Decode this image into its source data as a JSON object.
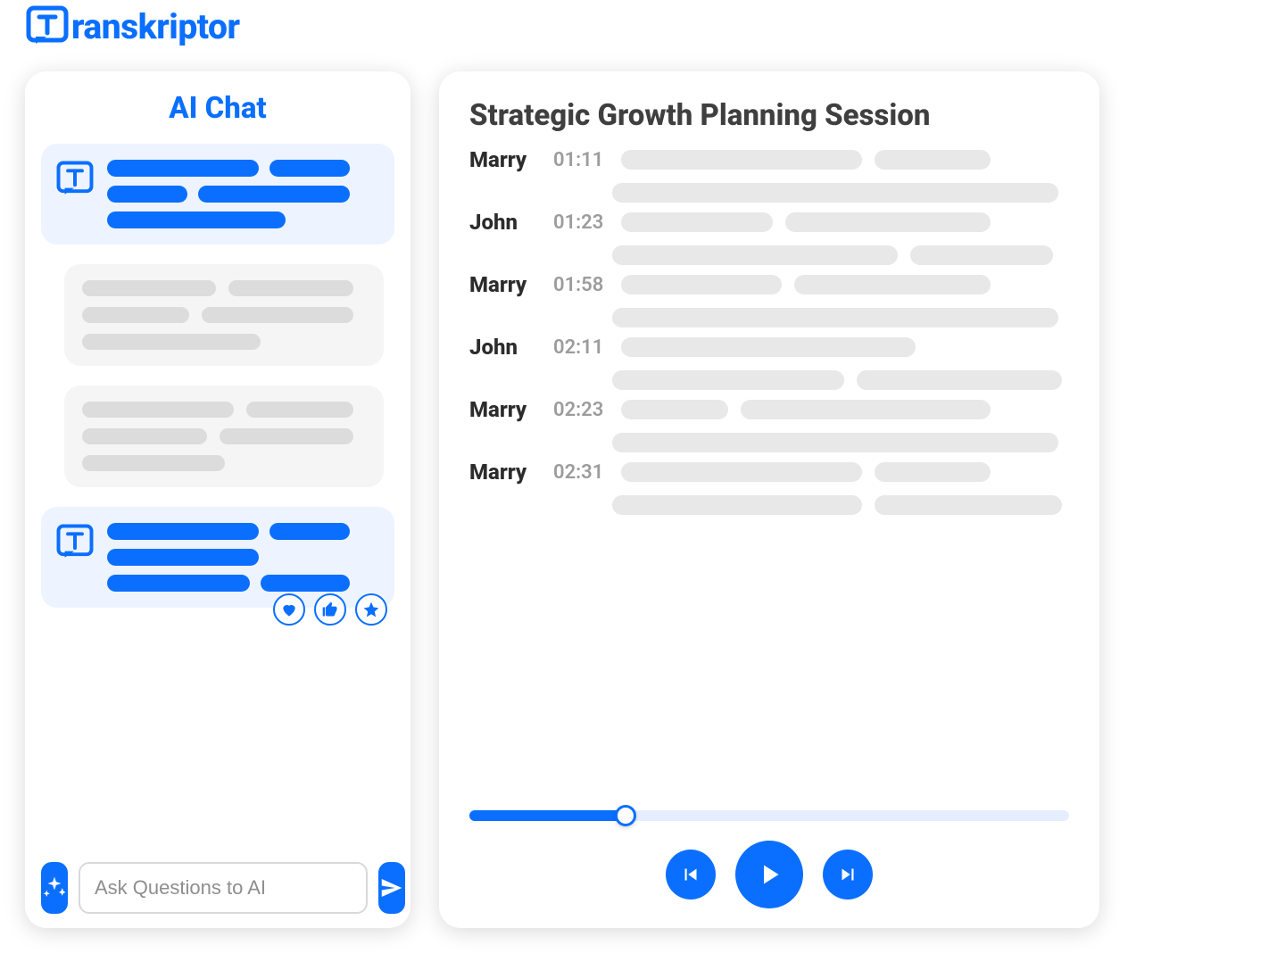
{
  "brand": {
    "name": "ranskriptor"
  },
  "chat": {
    "title": "AI Chat",
    "input_placeholder": "Ask Questions to AI"
  },
  "session": {
    "title": "Strategic Growth Planning Session",
    "entries": [
      {
        "speaker": "Marry",
        "time": "01:11"
      },
      {
        "speaker": "John",
        "time": "01:23"
      },
      {
        "speaker": "Marry",
        "time": "01:58"
      },
      {
        "speaker": "John",
        "time": "02:11"
      },
      {
        "speaker": "Marry",
        "time": "02:23"
      },
      {
        "speaker": "Marry",
        "time": "02:31"
      }
    ],
    "progress_percent": 26
  }
}
